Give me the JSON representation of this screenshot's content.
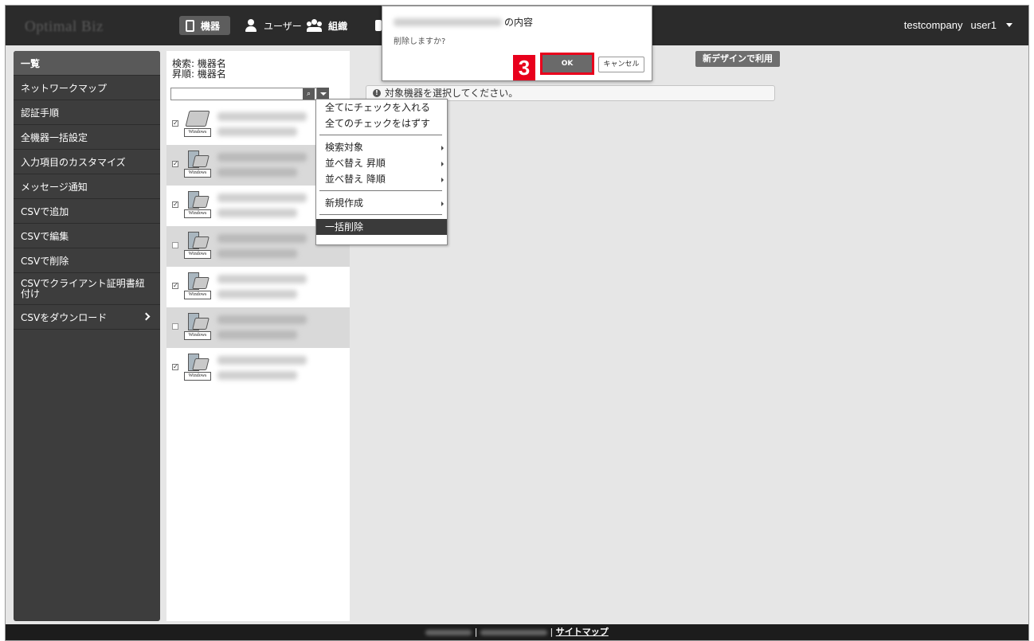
{
  "header": {
    "logo": "Optimal Biz",
    "nav": [
      {
        "label": "機器"
      },
      {
        "label": "ユーザー"
      },
      {
        "label": "組織"
      }
    ],
    "company": "testcompany",
    "user": "user1"
  },
  "sidebar": {
    "items": [
      {
        "label": "一覧"
      },
      {
        "label": "ネットワークマップ"
      },
      {
        "label": "認証手順"
      },
      {
        "label": "全機器一括設定"
      },
      {
        "label": "入力項目のカスタマイズ"
      },
      {
        "label": "メッセージ通知"
      },
      {
        "label": "CSVで追加"
      },
      {
        "label": "CSVで編集"
      },
      {
        "label": "CSVで削除"
      },
      {
        "label": "CSVでクライアント証明書紐付け"
      },
      {
        "label": "CSVをダウンロード"
      }
    ]
  },
  "list": {
    "search_line": "検索: 機器名",
    "sort_line": "昇順: 機器名",
    "device_label": "Windows",
    "devices": [
      {
        "checked": true,
        "selected": false
      },
      {
        "checked": true,
        "selected": true
      },
      {
        "checked": true,
        "selected": false
      },
      {
        "checked": false,
        "selected": true
      },
      {
        "checked": true,
        "selected": false
      },
      {
        "checked": false,
        "selected": true
      },
      {
        "checked": true,
        "selected": false
      }
    ]
  },
  "context_menu": {
    "items": [
      {
        "label": "全てにチェックを入れる"
      },
      {
        "label": "全てのチェックをはずす"
      },
      {
        "label": "検索対象"
      },
      {
        "label": "並べ替え 昇順"
      },
      {
        "label": "並べ替え 降順"
      },
      {
        "label": "新規作成"
      },
      {
        "label": "一括削除"
      }
    ]
  },
  "main": {
    "info_icon": "info-icon",
    "info_text": "対象機器を選択してください。",
    "new_design_button": "新デザインで利用"
  },
  "dialog": {
    "title_suffix": "の内容",
    "message": "削除しますか?",
    "ok_label": "OK",
    "cancel_label": "キャンセル",
    "step_number": "3",
    "highlight_color": "#e8001c"
  },
  "footer": {
    "sitemap_link": "サイトマップ"
  }
}
